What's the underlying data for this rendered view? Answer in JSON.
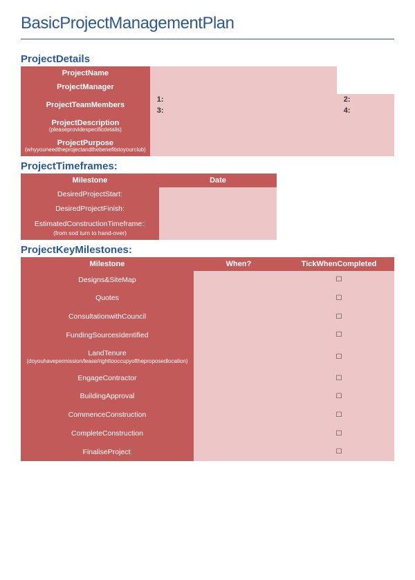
{
  "title": "BasicProjectManagementPlan",
  "sections": {
    "details": "ProjectDetails",
    "timeframes": "ProjectTimeframes:",
    "milestones": "ProjectKeyMilestones:"
  },
  "details": {
    "name_label": "ProjectName",
    "manager_label": "ProjectManager",
    "team_label": "ProjectTeamMembers",
    "team_slots": {
      "s1": "1:",
      "s2": "2:",
      "s3": "3:",
      "s4": "4:"
    },
    "description_label": "ProjectDescription",
    "description_sub": "(pleaseprovidespecificdetails)",
    "purpose_label": "ProjectPurpose",
    "purpose_sub": "(whyyouneedtheprojectandthebenefitstoyourclub)"
  },
  "timeframes": {
    "head_milestone": "Milestone",
    "head_date": "Date",
    "rows": [
      {
        "label": "DesiredProjectStart:",
        "sub": ""
      },
      {
        "label": "DesiredProjectFinish:",
        "sub": ""
      },
      {
        "label": "EstimatedConstructionTimeframe:",
        "sub": "(from sod turn to hand-over)"
      }
    ]
  },
  "keymilestones": {
    "head_milestone": "Milestone",
    "head_when": "When?",
    "head_tick": "TickWhenCompleted",
    "tick_char": "☐",
    "rows": [
      {
        "label": "Designs&SiteMap",
        "sub": ""
      },
      {
        "label": "Quotes",
        "sub": ""
      },
      {
        "label": "ConsultationwithCouncil",
        "sub": ""
      },
      {
        "label": "FundingSourcesIdentified",
        "sub": ""
      },
      {
        "label": "LandTenure",
        "sub": "(doyouhavepermission/lease/righttooccupyoftheproposedlocation)"
      },
      {
        "label": "EngageContractor",
        "sub": ""
      },
      {
        "label": "BuildingApproval",
        "sub": ""
      },
      {
        "label": "CommenceConstruction",
        "sub": ""
      },
      {
        "label": "CompleteConstruction",
        "sub": ""
      },
      {
        "label": "FinaliseProject",
        "sub": ""
      }
    ]
  }
}
